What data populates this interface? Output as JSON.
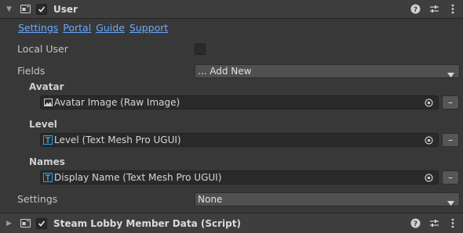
{
  "user_component": {
    "title": "User",
    "links": [
      "Settings",
      "Portal",
      "Guide",
      "Support"
    ],
    "local_user_label": "Local User",
    "fields_label": "Fields",
    "fields_dropdown_value": "... Add New",
    "avatar": {
      "label": "Avatar",
      "value": "Avatar Image (Raw Image)",
      "remove": "–"
    },
    "level": {
      "label": "Level",
      "value": "Level (Text Mesh Pro UGUI)",
      "remove": "–"
    },
    "names": {
      "label": "Names",
      "value": "Display Name (Text Mesh Pro UGUI)",
      "remove": "–"
    },
    "settings_label": "Settings",
    "settings_value": "None"
  },
  "next_component": {
    "title": "Steam Lobby Member Data (Script)"
  },
  "colors": {
    "link": "#6aa9ff",
    "background": "#383838",
    "header": "#3e3e3e",
    "tmp_icon": "#2aa3e0"
  }
}
